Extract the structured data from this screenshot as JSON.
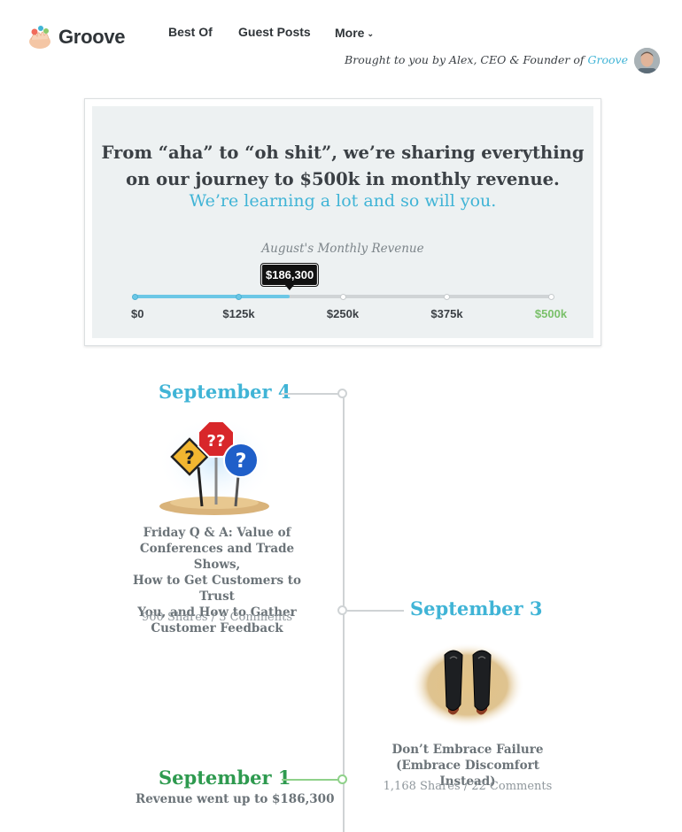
{
  "header": {
    "logo_text": "Groove",
    "nav": [
      {
        "label": "Best Of"
      },
      {
        "label": "Guest Posts"
      },
      {
        "label": "More"
      }
    ],
    "byline_prefix": "Brought to you by Alex, CEO & Founder of ",
    "byline_brand": "Groove"
  },
  "hero": {
    "headline_line1": "From “aha” to “oh shit”, we’re sharing everything",
    "headline_line2": "on our journey to $500k in monthly revenue.",
    "subhead": "We’re learning a lot and so will you.",
    "revenue_label": "August's Monthly Revenue",
    "current_revenue_label": "$186,300",
    "progress_fraction": 0.3726,
    "ticks": [
      {
        "label": "$0",
        "value": 0
      },
      {
        "label": "$125k",
        "value": 125000
      },
      {
        "label": "$250k",
        "value": 250000
      },
      {
        "label": "$375k",
        "value": 375000
      },
      {
        "label": "$500k",
        "value": 500000
      }
    ],
    "colors": {
      "accent": "#40b4d6",
      "goal": "#7ac06a",
      "fill": "#6cc7e6"
    }
  },
  "timeline": {
    "entries": [
      {
        "date": "September 4",
        "title_lines": [
          "Friday Q & A: Value of",
          "Conferences and Trade Shows,",
          "How to Get Customers to Trust",
          "You, and How to Gather",
          "Customer Feedback"
        ],
        "meta": "960 Shares / 3 Comments",
        "icon": "question-signs-icon"
      },
      {
        "date": "September 3",
        "title_lines": [
          "Don’t Embrace Failure",
          "(Embrace Discomfort Instead)"
        ],
        "meta": "1,168 Shares / 22 Comments",
        "icon": "shoes-icon"
      },
      {
        "date": "September 1",
        "milestone": "Revenue went up to $186,300",
        "color": "#2e9a4f"
      }
    ]
  }
}
